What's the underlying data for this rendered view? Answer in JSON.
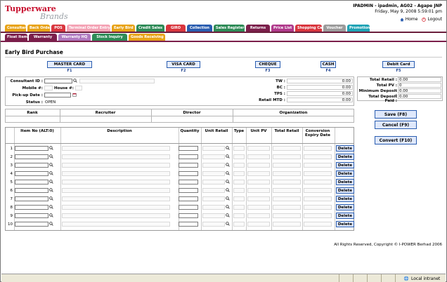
{
  "header": {
    "logo_main": "Tupperware",
    "logo_sub": "Brands",
    "user_line": "IPADMIN - ipadmin, AG02 - Agape JNP",
    "datetime": "Friday, May 9, 2008 5:59:01 pm",
    "home_label": "Home",
    "logout_label": "Logout"
  },
  "nav_row1": [
    {
      "label": "Consultant",
      "color": "#e8a317"
    },
    {
      "label": "Back Order",
      "color": "#e8a317"
    },
    {
      "label": "POS",
      "color": "#d9363e"
    },
    {
      "label": "Terminal Order Entry",
      "color": "#f4a3b5"
    },
    {
      "label": "Early Bird",
      "color": "#e8a317"
    },
    {
      "label": "Credit Sales",
      "color": "#2e8b57"
    },
    {
      "label": "GIRO",
      "color": "#d9363e"
    },
    {
      "label": "Collection",
      "color": "#2a5db0"
    },
    {
      "label": "Sales Register",
      "color": "#2e8b57"
    },
    {
      "label": "Returns",
      "color": "#7b1f4b"
    },
    {
      "label": "Price List",
      "color": "#b03a8c"
    },
    {
      "label": "Shopping Cart",
      "color": "#d9363e"
    },
    {
      "label": "Voucher",
      "color": "#9b9b9b"
    },
    {
      "label": "Promotion",
      "color": "#1fa3b5"
    }
  ],
  "nav_row2": [
    {
      "label": "Float Item",
      "color": "#7b1f4b"
    },
    {
      "label": "Warranty",
      "color": "#7b1f4b"
    },
    {
      "label": "Warranty HQ",
      "color": "#b07ac0"
    },
    {
      "label": "Stock Inquiry",
      "color": "#2e8b57"
    },
    {
      "label": "Goods Receiving",
      "color": "#e8a317"
    }
  ],
  "page_title": "Early Bird Purchase",
  "payment_methods": [
    {
      "label": "MASTER CARD",
      "key": "F1"
    },
    {
      "label": "VISA CARD",
      "key": "F2"
    },
    {
      "label": "CHEQUE",
      "key": "F3"
    },
    {
      "label": "CASH",
      "key": "F4"
    },
    {
      "label": "Debit Card",
      "key": "F5"
    }
  ],
  "consultant_form": {
    "consultant_id_label": "Consultant ID :",
    "mobile_label": "Mobile #:",
    "house_label": "House #:",
    "pickup_label": "Pick-up Date :",
    "status_label": "Status :",
    "status_value": "OPEN"
  },
  "metrics": [
    {
      "label": "TW :",
      "value": "0.00"
    },
    {
      "label": "BC :",
      "value": "0.00"
    },
    {
      "label": "TPS :",
      "value": "0.00"
    },
    {
      "label": "Retail MTD :",
      "value": "0.00"
    }
  ],
  "totals": [
    {
      "label": "Total Retail :",
      "value": "0.00"
    },
    {
      "label": "Total PV :",
      "value": "0"
    },
    {
      "label": "Minimum Deposit :",
      "value": "0.00"
    },
    {
      "label": "Total Deposit Paid :",
      "value": "0.00"
    }
  ],
  "rank_table": {
    "headers": [
      "Rank",
      "Recruiter",
      "Director",
      "Organization"
    ]
  },
  "actions": {
    "save": "Save (F8)",
    "cancel": "Cancel (F9)",
    "convert": "Convert (F10)"
  },
  "item_table": {
    "headers": [
      "Item No (ALT:0)",
      "Description",
      "Quantity",
      "Unit Retail",
      "Type",
      "Unit PV",
      "Total Retail",
      "Conversion Expiry Date"
    ],
    "rows": [
      "1",
      "2",
      "3",
      "4",
      "5",
      "6",
      "7",
      "8",
      "9",
      "10"
    ],
    "delete_label": "Delete"
  },
  "copyright": "All Rights Reserved, Copyright © I-POWER Berhad 2006",
  "statusbar": {
    "zone": "Local intranet"
  }
}
